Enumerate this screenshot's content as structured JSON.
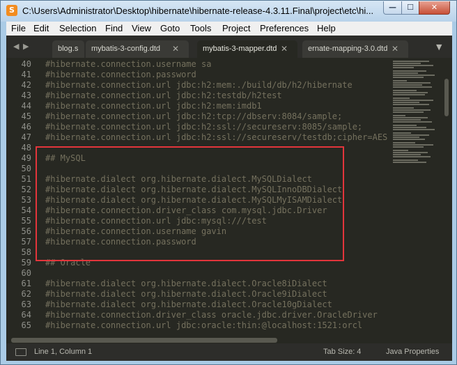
{
  "window": {
    "title": "C:\\Users\\Administrator\\Desktop\\hibernate\\hibernate-release-4.3.11.Final\\project\\etc\\hi...",
    "app_icon": "S",
    "minimize_glyph": "—",
    "maximize_glyph": "☐",
    "close_glyph": "✕"
  },
  "menu": [
    "File",
    "Edit",
    "Selection",
    "Find",
    "View",
    "Goto",
    "Tools",
    "Project",
    "Preferences",
    "Help"
  ],
  "tabs": [
    {
      "label": "blog.s"
    },
    {
      "label": "mybatis-3-config.dtd"
    },
    {
      "label": "mybatis-3-mapper.dtd"
    },
    {
      "label": "ernate-mapping-3.0.dtd"
    }
  ],
  "tab_nav": {
    "left": "◀",
    "right": "▶",
    "close": "✕",
    "dropdown": "▼"
  },
  "editor": {
    "line_numbers": [
      "40",
      "41",
      "42",
      "43",
      "44",
      "45",
      "46",
      "47",
      "48",
      "49",
      "50",
      "51",
      "52",
      "53",
      "54",
      "55",
      "56",
      "57",
      "58",
      "59",
      "60",
      "61",
      "62",
      "63",
      "64",
      "65"
    ],
    "lines": [
      "#hibernate.connection.username sa",
      "#hibernate.connection.password",
      "#hibernate.connection.url jdbc:h2:mem:./build/db/h2/hibernate",
      "#hibernate.connection.url jdbc:h2:testdb/h2test",
      "#hibernate.connection.url jdbc:h2:mem:imdb1",
      "#hibernate.connection.url jdbc:h2:tcp://dbserv:8084/sample;",
      "#hibernate.connection.url jdbc:h2:ssl://secureserv:8085/sample;",
      "#hibernate.connection.url jdbc:h2:ssl://secureserv/testdb;cipher=AES",
      "",
      "## MySQL",
      "",
      "#hibernate.dialect org.hibernate.dialect.MySQLDialect",
      "#hibernate.dialect org.hibernate.dialect.MySQLInnoDBDialect",
      "#hibernate.dialect org.hibernate.dialect.MySQLMyISAMDialect",
      "#hibernate.connection.driver_class com.mysql.jdbc.Driver",
      "#hibernate.connection.url jdbc:mysql:///test",
      "#hibernate.connection.username gavin",
      "#hibernate.connection.password",
      "",
      "## Oracle",
      "",
      "#hibernate.dialect org.hibernate.dialect.Oracle8iDialect",
      "#hibernate.dialect org.hibernate.dialect.Oracle9iDialect",
      "#hibernate.dialect org.hibernate.dialect.Oracle10gDialect",
      "#hibernate.connection.driver_class oracle.jdbc.driver.OracleDriver",
      "#hibernate.connection.url jdbc:oracle:thin:@localhost:1521:orcl"
    ],
    "highlight_color": "#e3353b"
  },
  "status": {
    "position": "Line 1, Column 1",
    "tab_size": "Tab Size: 4",
    "syntax": "Java Properties"
  },
  "colors": {
    "editor_bg": "#272822",
    "comment": "#75715e",
    "line_number": "#8f908a"
  }
}
